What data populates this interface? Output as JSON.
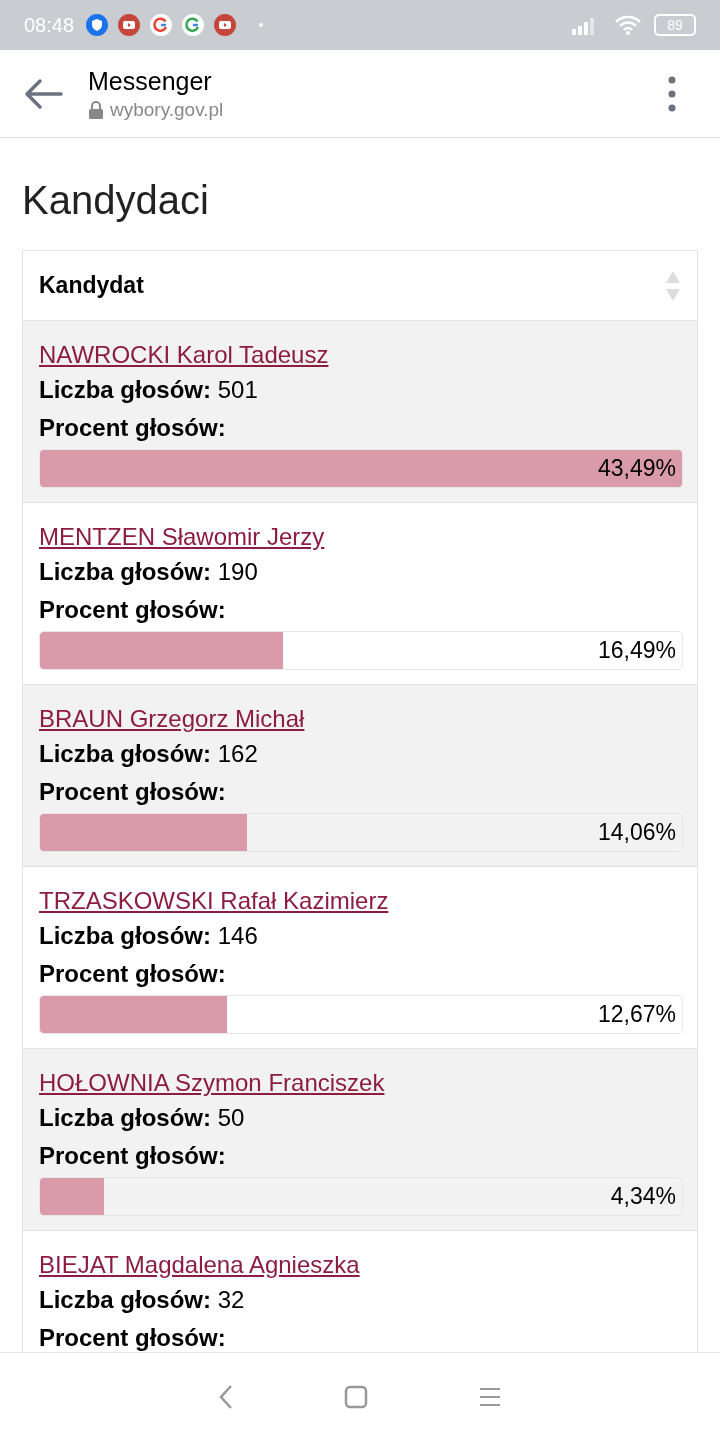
{
  "status_bar": {
    "time": "08:48",
    "battery": "89"
  },
  "header": {
    "title": "Messenger",
    "url": "wybory.gov.pl"
  },
  "heading": "Kandydaci",
  "table": {
    "column": "Kandydat",
    "rows": [
      {
        "name": "NAWROCKI Karol Tadeusz",
        "votes_label": "Liczba głosów:",
        "votes": "501",
        "percent_label": "Procent głosów:",
        "level": 1,
        "percent": "43,49%"
      },
      {
        "name": "MENTZEN Sławomir Jerzy",
        "votes_label": "Liczba głosów:",
        "votes": "190",
        "percent_label": "Procent głosów:",
        "level": 0.379,
        "percent": "16,49%"
      },
      {
        "name": "BRAUN Grzegorz Michał",
        "votes_label": "Liczba głosów:",
        "votes": "162",
        "percent_label": "Procent głosów:",
        "level": 0.323,
        "percent": "14,06%"
      },
      {
        "name": "TRZASKOWSKI Rafał Kazimierz",
        "votes_label": "Liczba głosów:",
        "votes": "146",
        "percent_label": "Procent głosów:",
        "level": 0.291,
        "percent": "12,67%"
      },
      {
        "name": "HOŁOWNIA Szymon Franciszek",
        "votes_label": "Liczba głosów:",
        "votes": "50",
        "percent_label": "Procent głosów:",
        "level": 0.0998,
        "percent": "4,34%"
      },
      {
        "name": "BIEJAT Magdalena Agnieszka",
        "votes_label": "Liczba głosów:",
        "votes": "32",
        "percent_label": "Procent głosów:"
      }
    ]
  }
}
